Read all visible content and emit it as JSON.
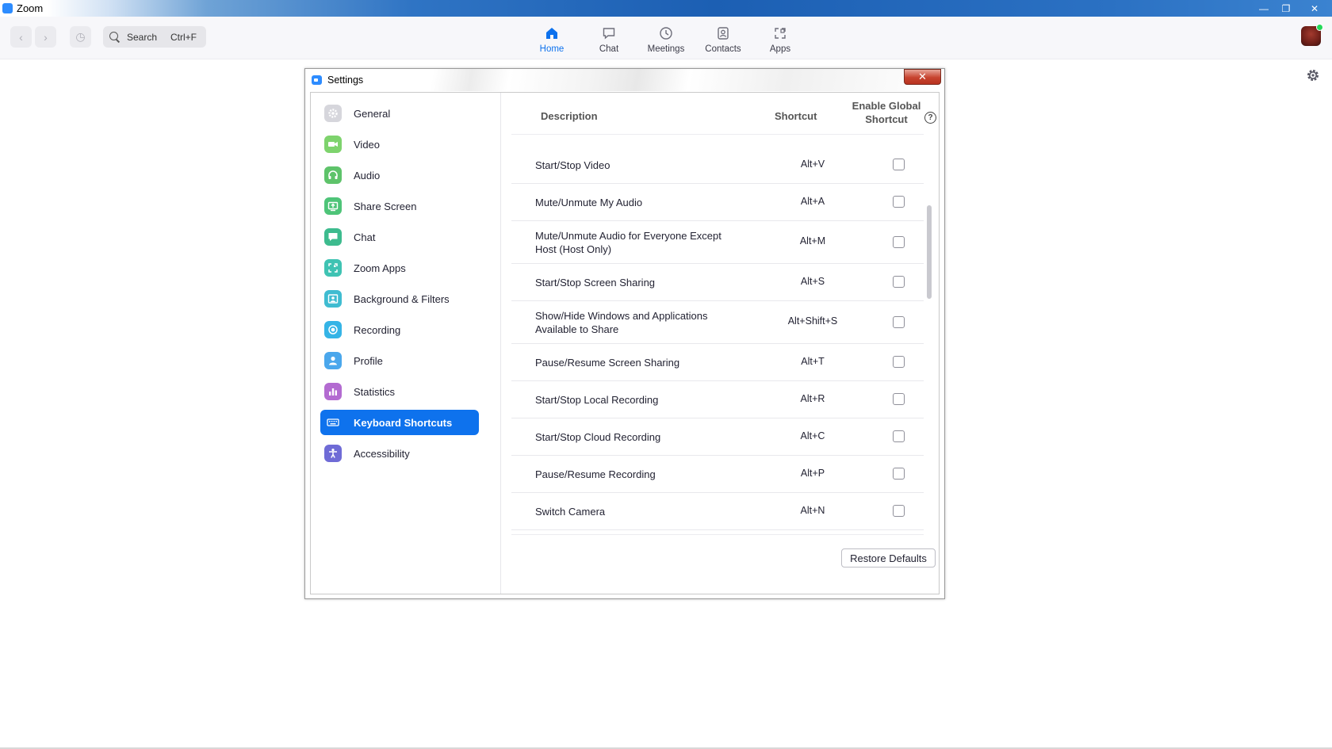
{
  "os_window": {
    "title": "Zoom",
    "controls": [
      "minimize",
      "restore",
      "close"
    ]
  },
  "toolbar": {
    "search_label": "Search",
    "search_shortcut": "Ctrl+F",
    "tabs": [
      {
        "label": "Home",
        "icon": "home-icon",
        "active": true
      },
      {
        "label": "Chat",
        "icon": "chat-bubble-icon",
        "active": false
      },
      {
        "label": "Meetings",
        "icon": "clock-icon",
        "active": false
      },
      {
        "label": "Contacts",
        "icon": "contacts-icon",
        "active": false
      },
      {
        "label": "Apps",
        "icon": "apps-icon",
        "active": false
      }
    ],
    "accent_color": "#0e72ed"
  },
  "dialog": {
    "title": "Settings",
    "close_label": "✕",
    "sidebar": {
      "items": [
        {
          "label": "General",
          "icon": "gear-icon",
          "color": "#d6d6dc"
        },
        {
          "label": "Video",
          "icon": "video-icon",
          "color": "#7ed36d"
        },
        {
          "label": "Audio",
          "icon": "headphones-icon",
          "color": "#5ec36a"
        },
        {
          "label": "Share Screen",
          "icon": "share-screen-icon",
          "color": "#4ec478"
        },
        {
          "label": "Chat",
          "icon": "chat-icon",
          "color": "#3dbb8e"
        },
        {
          "label": "Zoom Apps",
          "icon": "zoom-apps-icon",
          "color": "#3fc3b3"
        },
        {
          "label": "Background & Filters",
          "icon": "background-icon",
          "color": "#3fbcd1"
        },
        {
          "label": "Recording",
          "icon": "record-icon",
          "color": "#35b4e6"
        },
        {
          "label": "Profile",
          "icon": "profile-icon",
          "color": "#4aa7ec"
        },
        {
          "label": "Statistics",
          "icon": "statistics-icon",
          "color": "#b36bd1"
        },
        {
          "label": "Keyboard Shortcuts",
          "icon": "keyboard-icon",
          "color": "#0e72ed",
          "active": true
        },
        {
          "label": "Accessibility",
          "icon": "accessibility-icon",
          "color": "#6f6bd6"
        }
      ]
    },
    "shortcuts": {
      "headers": {
        "description": "Description",
        "shortcut": "Shortcut",
        "global_line1": "Enable Global",
        "global_line2": "Shortcut",
        "help": "?"
      },
      "rows": [
        {
          "description": "Start/Stop Video",
          "shortcut": "Alt+V",
          "global": false
        },
        {
          "description": "Mute/Unmute My Audio",
          "shortcut": "Alt+A",
          "global": false
        },
        {
          "description": "Mute/Unmute Audio for Everyone Except Host (Host Only)",
          "shortcut": "Alt+M",
          "global": false
        },
        {
          "description": "Start/Stop Screen Sharing",
          "shortcut": "Alt+S",
          "global": false
        },
        {
          "description": "Show/Hide Windows and Applications Available to Share",
          "shortcut": "Alt+Shift+S",
          "global": false
        },
        {
          "description": "Pause/Resume Screen Sharing",
          "shortcut": "Alt+T",
          "global": false
        },
        {
          "description": "Start/Stop Local Recording",
          "shortcut": "Alt+R",
          "global": false
        },
        {
          "description": "Start/Stop Cloud Recording",
          "shortcut": "Alt+C",
          "global": false
        },
        {
          "description": "Pause/Resume Recording",
          "shortcut": "Alt+P",
          "global": false
        },
        {
          "description": "Switch Camera",
          "shortcut": "Alt+N",
          "global": false
        }
      ],
      "restore_label": "Restore Defaults"
    }
  }
}
